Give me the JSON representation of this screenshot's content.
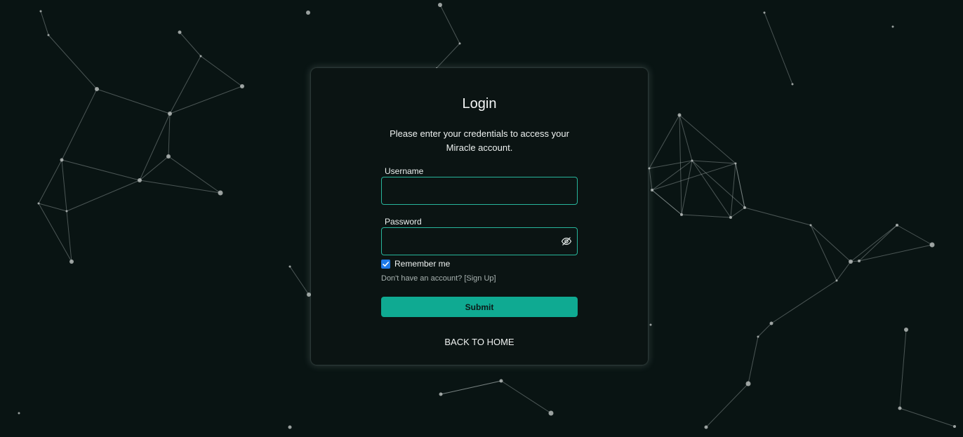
{
  "login": {
    "title": "Login",
    "subtitle": "Please enter your credentials to access your Miracle account.",
    "username_label": "Username",
    "username_value": "",
    "password_label": "Password",
    "password_value": "",
    "password_toggle_icon": "eye-slash-icon",
    "remember_label": "Remember me",
    "remember_checked": true,
    "signup_prompt": "Don't have an account?",
    "signup_link": "[Sign Up]",
    "submit_label": "Submit",
    "back_label": "BACK TO HOME"
  },
  "colors": {
    "background": "#091413",
    "card": "#0b1413",
    "accent": "#0faa92",
    "field_border": "#27b59b",
    "checkbox": "#1f7ae8"
  }
}
